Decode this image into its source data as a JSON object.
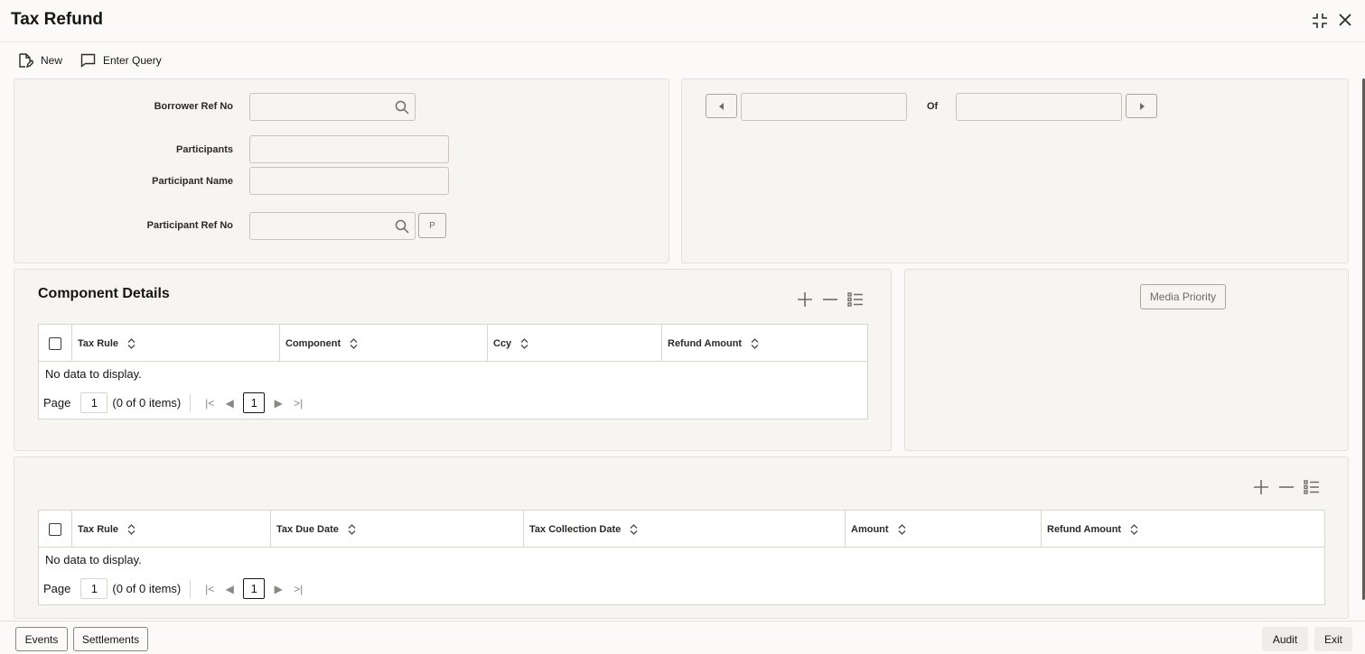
{
  "window": {
    "title": "Tax Refund"
  },
  "toolbar": {
    "new_label": "New",
    "enter_query_label": "Enter Query"
  },
  "form": {
    "borrower_ref_no": {
      "label": "Borrower Ref No",
      "value": ""
    },
    "participants": {
      "label": "Participants",
      "value": ""
    },
    "participant_name": {
      "label": "Participant Name",
      "value": ""
    },
    "participant_ref_no": {
      "label": "Participant Ref No",
      "value": "",
      "p_button": "P"
    }
  },
  "record_nav": {
    "current": "",
    "of_label": "Of",
    "total": ""
  },
  "component_details": {
    "title": "Component Details",
    "columns": [
      "Tax Rule",
      "Component",
      "Ccy",
      "Refund Amount"
    ],
    "rows": [],
    "empty_text": "No data to display.",
    "pager": {
      "page_label": "Page",
      "page_value": "1",
      "items_text": "(0 of 0 items)",
      "current_page": "1"
    }
  },
  "media": {
    "priority_button": "Media Priority"
  },
  "tax_details": {
    "columns": [
      "Tax Rule",
      "Tax Due Date",
      "Tax Collection Date",
      "Amount",
      "Refund Amount"
    ],
    "rows": [],
    "empty_text": "No data to display.",
    "pager": {
      "page_label": "Page",
      "page_value": "1",
      "items_text": "(0 of 0 items)",
      "current_page": "1"
    }
  },
  "footer": {
    "events": "Events",
    "settlements": "Settlements",
    "audit": "Audit",
    "exit": "Exit"
  }
}
